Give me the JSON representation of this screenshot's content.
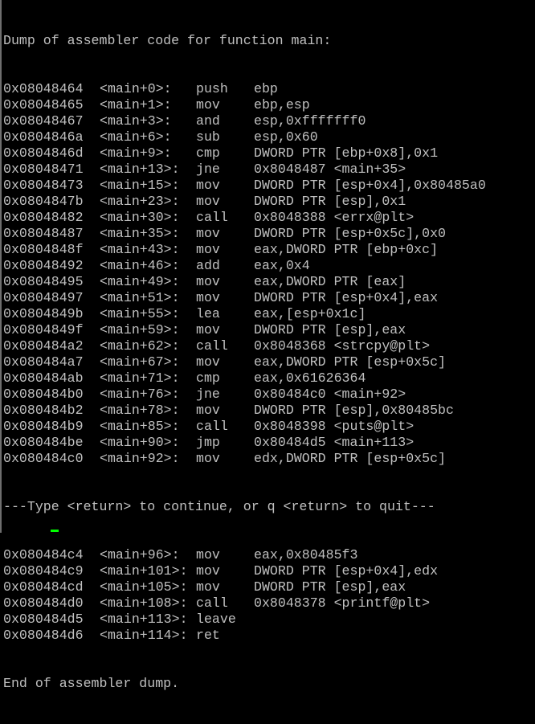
{
  "terminal": {
    "header": "Dump of assembler code for function main:",
    "pager_prompt": "---Type <return> to continue, or q <return> to quit---",
    "footer": "End of assembler dump.",
    "cursor_color": "#00ff00",
    "text_color": "#c0c0c0",
    "background_color": "#000000",
    "instructions_page1": [
      {
        "addr": "0x08048464",
        "sym": "<main+0>:",
        "mnem": "push",
        "ops": "ebp"
      },
      {
        "addr": "0x08048465",
        "sym": "<main+1>:",
        "mnem": "mov",
        "ops": "ebp,esp"
      },
      {
        "addr": "0x08048467",
        "sym": "<main+3>:",
        "mnem": "and",
        "ops": "esp,0xfffffff0"
      },
      {
        "addr": "0x0804846a",
        "sym": "<main+6>:",
        "mnem": "sub",
        "ops": "esp,0x60"
      },
      {
        "addr": "0x0804846d",
        "sym": "<main+9>:",
        "mnem": "cmp",
        "ops": "DWORD PTR [ebp+0x8],0x1"
      },
      {
        "addr": "0x08048471",
        "sym": "<main+13>:",
        "mnem": "jne",
        "ops": "0x8048487 <main+35>"
      },
      {
        "addr": "0x08048473",
        "sym": "<main+15>:",
        "mnem": "mov",
        "ops": "DWORD PTR [esp+0x4],0x80485a0"
      },
      {
        "addr": "0x0804847b",
        "sym": "<main+23>:",
        "mnem": "mov",
        "ops": "DWORD PTR [esp],0x1"
      },
      {
        "addr": "0x08048482",
        "sym": "<main+30>:",
        "mnem": "call",
        "ops": "0x8048388 <errx@plt>"
      },
      {
        "addr": "0x08048487",
        "sym": "<main+35>:",
        "mnem": "mov",
        "ops": "DWORD PTR [esp+0x5c],0x0"
      },
      {
        "addr": "0x0804848f",
        "sym": "<main+43>:",
        "mnem": "mov",
        "ops": "eax,DWORD PTR [ebp+0xc]"
      },
      {
        "addr": "0x08048492",
        "sym": "<main+46>:",
        "mnem": "add",
        "ops": "eax,0x4"
      },
      {
        "addr": "0x08048495",
        "sym": "<main+49>:",
        "mnem": "mov",
        "ops": "eax,DWORD PTR [eax]"
      },
      {
        "addr": "0x08048497",
        "sym": "<main+51>:",
        "mnem": "mov",
        "ops": "DWORD PTR [esp+0x4],eax"
      },
      {
        "addr": "0x0804849b",
        "sym": "<main+55>:",
        "mnem": "lea",
        "ops": "eax,[esp+0x1c]"
      },
      {
        "addr": "0x0804849f",
        "sym": "<main+59>:",
        "mnem": "mov",
        "ops": "DWORD PTR [esp],eax"
      },
      {
        "addr": "0x080484a2",
        "sym": "<main+62>:",
        "mnem": "call",
        "ops": "0x8048368 <strcpy@plt>"
      },
      {
        "addr": "0x080484a7",
        "sym": "<main+67>:",
        "mnem": "mov",
        "ops": "eax,DWORD PTR [esp+0x5c]"
      },
      {
        "addr": "0x080484ab",
        "sym": "<main+71>:",
        "mnem": "cmp",
        "ops": "eax,0x61626364"
      },
      {
        "addr": "0x080484b0",
        "sym": "<main+76>:",
        "mnem": "jne",
        "ops": "0x80484c0 <main+92>"
      },
      {
        "addr": "0x080484b2",
        "sym": "<main+78>:",
        "mnem": "mov",
        "ops": "DWORD PTR [esp],0x80485bc"
      },
      {
        "addr": "0x080484b9",
        "sym": "<main+85>:",
        "mnem": "call",
        "ops": "0x8048398 <puts@plt>"
      },
      {
        "addr": "0x080484be",
        "sym": "<main+90>:",
        "mnem": "jmp",
        "ops": "0x80484d5 <main+113>"
      },
      {
        "addr": "0x080484c0",
        "sym": "<main+92>:",
        "mnem": "mov",
        "ops": "edx,DWORD PTR [esp+0x5c]"
      }
    ],
    "instructions_page2": [
      {
        "addr": "0x080484c4",
        "sym": "<main+96>:",
        "mnem": "mov",
        "ops": "eax,0x80485f3"
      },
      {
        "addr": "0x080484c9",
        "sym": "<main+101>:",
        "mnem": "mov",
        "ops": "DWORD PTR [esp+0x4],edx"
      },
      {
        "addr": "0x080484cd",
        "sym": "<main+105>:",
        "mnem": "mov",
        "ops": "DWORD PTR [esp],eax"
      },
      {
        "addr": "0x080484d0",
        "sym": "<main+108>:",
        "mnem": "call",
        "ops": "0x8048378 <printf@plt>"
      },
      {
        "addr": "0x080484d5",
        "sym": "<main+113>:",
        "mnem": "leave",
        "ops": ""
      },
      {
        "addr": "0x080484d6",
        "sym": "<main+114>:",
        "mnem": "ret",
        "ops": ""
      }
    ]
  }
}
